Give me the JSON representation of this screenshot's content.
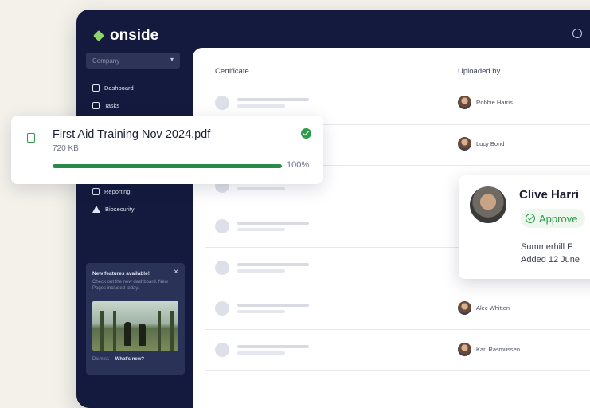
{
  "app": {
    "brand": "onside"
  },
  "sidebar": {
    "company_placeholder": "Company",
    "items": [
      {
        "label": "Dashboard",
        "icon": "grid-icon"
      },
      {
        "label": "Tasks",
        "icon": "checklist-icon"
      },
      {
        "label": "Reporting",
        "icon": "report-icon"
      },
      {
        "label": "Biosecurity",
        "icon": "warning-icon"
      }
    ],
    "promo": {
      "title": "New features available!",
      "body": "Check out the new dashboard. New Pages included today.",
      "dismiss": "Dismiss",
      "cta": "What's new?"
    }
  },
  "table": {
    "headers": [
      "Certificate",
      "Uploaded by"
    ],
    "rows": [
      {
        "uploader": "Robbie Harris"
      },
      {
        "uploader": "Lucy Bond"
      },
      {
        "uploader": ""
      },
      {
        "uploader": ""
      },
      {
        "uploader": ""
      },
      {
        "uploader": "Alec Whitten"
      },
      {
        "uploader": "Kari Rasmussen"
      }
    ]
  },
  "profile_card": {
    "name": "Clive Harri",
    "status": "Approve",
    "farm": "Summerhill F",
    "added": "Added 12 June"
  },
  "upload": {
    "file_name": "First Aid Training Nov 2024.pdf",
    "file_size": "720 KB",
    "progress_pct": 100,
    "progress_label": "100%"
  },
  "colors": {
    "navy": "#131a3d",
    "accent_green": "#2f9a4a",
    "logo_green": "#8fd46b"
  }
}
